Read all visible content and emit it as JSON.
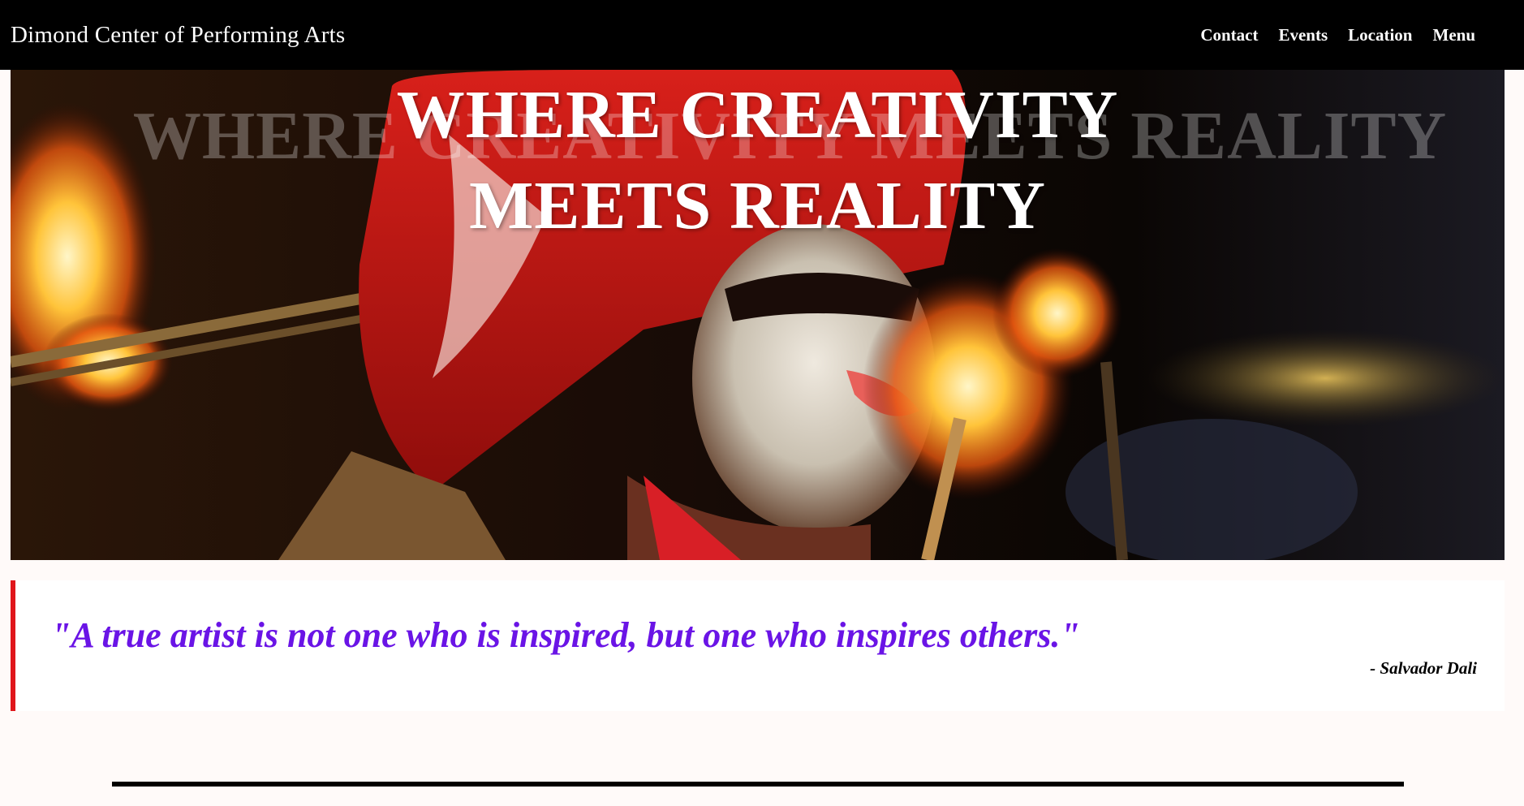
{
  "navbar": {
    "brand": "Dimond Center of Performing Arts",
    "links": [
      {
        "label": "Contact"
      },
      {
        "label": "Events"
      },
      {
        "label": "Location"
      },
      {
        "label": "Menu"
      }
    ]
  },
  "hero": {
    "title_line1": "WHERE CREATIVITY",
    "title_line2": "MEETS REALITY",
    "image": "performer-with-fire-torches"
  },
  "quote": {
    "text": "\"A true artist is not one who is inspired, but one who inspires others.\"",
    "author": "- Salvador Dali"
  },
  "colors": {
    "navbar_bg": "#000000",
    "quote_text": "#6a14e6",
    "quote_border": "#e0161b",
    "page_bg": "#fffaf9"
  }
}
